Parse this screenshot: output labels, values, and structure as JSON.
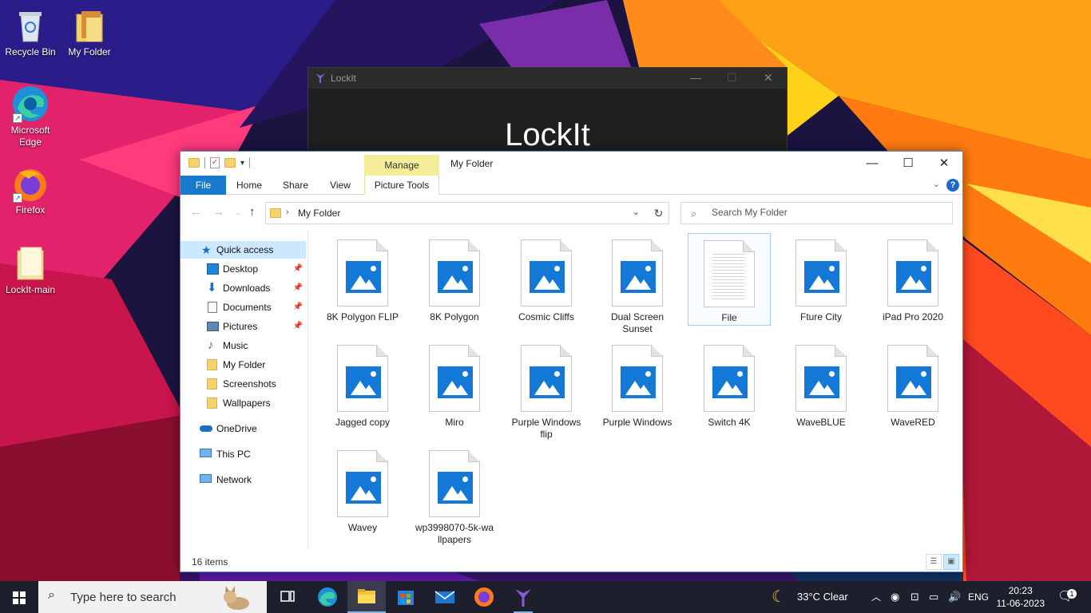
{
  "desktop": {
    "icons": [
      {
        "label": "Recycle Bin"
      },
      {
        "label": "My Folder"
      },
      {
        "label": "Microsoft Edge"
      },
      {
        "label": "Firefox"
      },
      {
        "label": "LockIt-main"
      }
    ]
  },
  "lockit": {
    "title": "LockIt",
    "heading": "LockIt",
    "controls": {
      "minimize": "—",
      "maximize": "☐",
      "close": "✕"
    }
  },
  "explorer": {
    "title": "My Folder",
    "contextual_tab": "Manage",
    "window_controls": {
      "minimize": "—",
      "maximize": "☐",
      "close": "✕"
    },
    "ribbon_tabs": [
      "File",
      "Home",
      "Share",
      "View",
      "Picture Tools"
    ],
    "address": {
      "path": "My Folder"
    },
    "search": {
      "placeholder": "Search My Folder"
    },
    "nav": {
      "quick_access": "Quick access",
      "items": [
        "Desktop",
        "Downloads",
        "Documents",
        "Pictures",
        "Music",
        "My Folder",
        "Screenshots",
        "Wallpapers"
      ],
      "onedrive": "OneDrive",
      "this_pc": "This PC",
      "network": "Network"
    },
    "files": [
      {
        "name": "8K Polygon FLIP",
        "type": "image"
      },
      {
        "name": "8K Polygon",
        "type": "image"
      },
      {
        "name": "Cosmic Cliffs",
        "type": "image"
      },
      {
        "name": "Dual Screen Sunset",
        "type": "image"
      },
      {
        "name": "File",
        "type": "document"
      },
      {
        "name": "Fture City",
        "type": "image"
      },
      {
        "name": "iPad Pro 2020",
        "type": "image"
      },
      {
        "name": "Jagged copy",
        "type": "image"
      },
      {
        "name": "Miro",
        "type": "image"
      },
      {
        "name": "Purple Windows flip",
        "type": "image"
      },
      {
        "name": "Purple Windows",
        "type": "image"
      },
      {
        "name": "Switch 4K",
        "type": "image"
      },
      {
        "name": "WaveBLUE",
        "type": "image"
      },
      {
        "name": "WaveRED",
        "type": "image"
      },
      {
        "name": "Wavey",
        "type": "image"
      },
      {
        "name": "wp3998070-5k-wallpapers",
        "type": "image"
      }
    ],
    "status": "16 items"
  },
  "taskbar": {
    "search_placeholder": "Type here to search",
    "weather": "33°C  Clear",
    "language": "ENG",
    "time": "20:23",
    "date": "11-06-2023",
    "notifications": "1"
  },
  "colors": {
    "accent": "#1979ca",
    "selection": "#cce8ff",
    "manage_tab": "#f4ee9a",
    "taskbar": "#1e1f2c"
  }
}
